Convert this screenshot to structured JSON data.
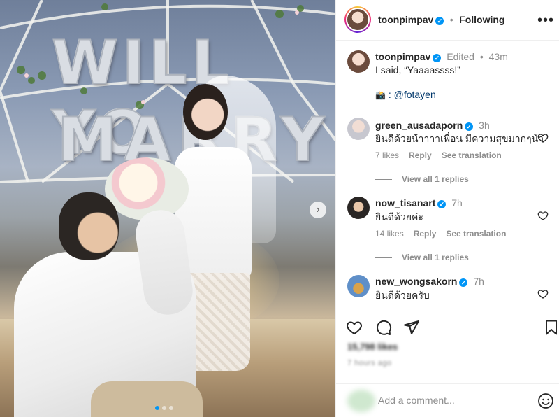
{
  "post": {
    "balloon_row1": "WILL YO",
    "balloon_row2": "MARRY",
    "carousel_dots": 3,
    "active_dot": 0
  },
  "header": {
    "username": "toonpimpav",
    "separator": "•",
    "follow_status": "Following",
    "more_label": "•••"
  },
  "caption": {
    "username": "toonpimpav",
    "edited": "Edited",
    "separator": "•",
    "time": "43m",
    "text": "I said, “Yaaaassss!”",
    "credit_icon": "📸",
    "credit_text": ": @fotayen"
  },
  "comments": [
    {
      "username": "green_ausadaporn",
      "time": "3h",
      "text": "ยินดีด้วยน้าาาาเพื่อน มีความสุขมากๆน้า",
      "likes": "7 likes",
      "reply_label": "Reply",
      "translate_label": "See translation",
      "view_replies": "View all 1 replies"
    },
    {
      "username": "now_tisanart",
      "time": "7h",
      "text": "ยินดีด้วยค่ะ",
      "likes": "14 likes",
      "reply_label": "Reply",
      "translate_label": "See translation",
      "view_replies": "View all 1 replies"
    },
    {
      "username": "new_wongsakorn",
      "time": "7h",
      "text": "ยินดีด้วยครับ"
    }
  ],
  "footer": {
    "likes_blurred": "15,798 likes",
    "time_blurred": "7 hours ago",
    "comment_placeholder": "Add a comment..."
  },
  "icons": {
    "verified": "verified-badge",
    "heart": "heart-icon",
    "comment": "comment-icon",
    "share": "share-icon",
    "save": "bookmark-icon",
    "emoji": "smiley-icon",
    "next": "chevron-right-icon"
  },
  "colors": {
    "verified_blue": "#0095f6",
    "text": "#262626",
    "muted": "#8e8e8e",
    "divider": "#efefef"
  }
}
